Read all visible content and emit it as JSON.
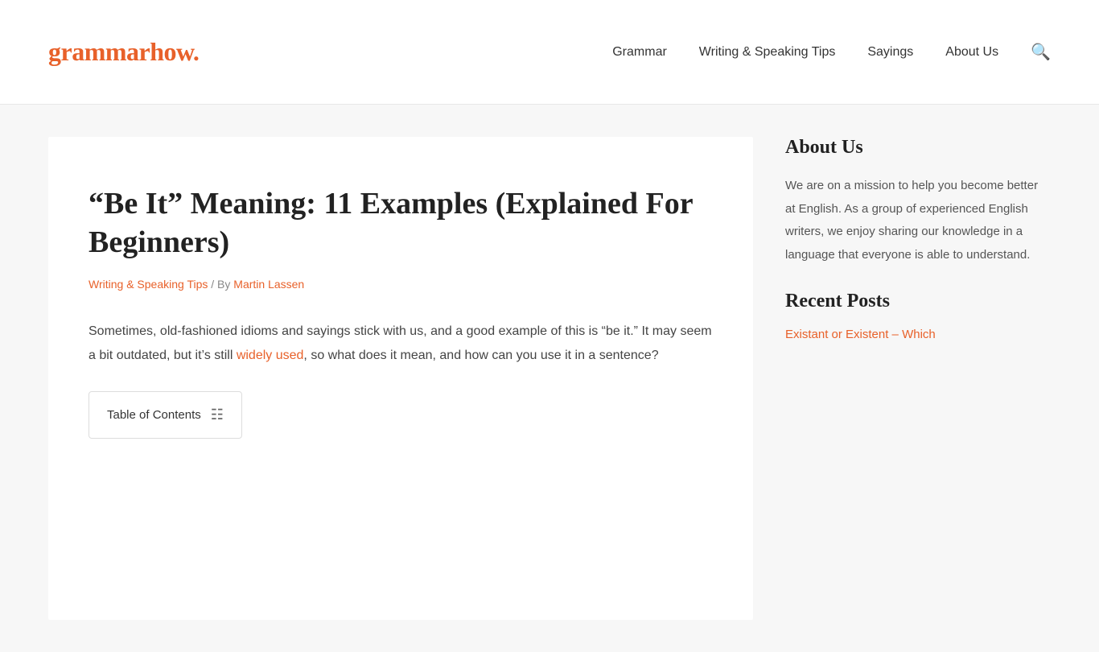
{
  "header": {
    "logo_text": "grammarhow",
    "logo_dot": ".",
    "nav": [
      {
        "label": "Grammar",
        "href": "#"
      },
      {
        "label": "Writing & Speaking Tips",
        "href": "#"
      },
      {
        "label": "Sayings",
        "href": "#"
      },
      {
        "label": "About Us",
        "href": "#"
      }
    ],
    "search_icon": "🔍"
  },
  "article": {
    "title": "“Be It” Meaning: 11 Examples (Explained For Beginners)",
    "category": "Writing & Speaking Tips",
    "author_prefix": "/ By",
    "author": "Martin Lassen",
    "intro_part1": "Sometimes, old-fashioned idioms and sayings stick with us, and a good example of this is “be it.” It may seem a bit outdated, but it’s still ",
    "intro_link_text": "widely used",
    "intro_part2": ", so what does it mean, and how can you use it in a sentence?",
    "toc_label": "Table of Contents"
  },
  "sidebar": {
    "about_heading": "About Us",
    "about_text": "We are on a mission to help you become better at English. As a group of experienced English writers, we enjoy sharing our knowledge in a language that everyone is able to understand.",
    "recent_posts_heading": "Recent Posts",
    "recent_post_link": "Existant or Existent – Which"
  }
}
